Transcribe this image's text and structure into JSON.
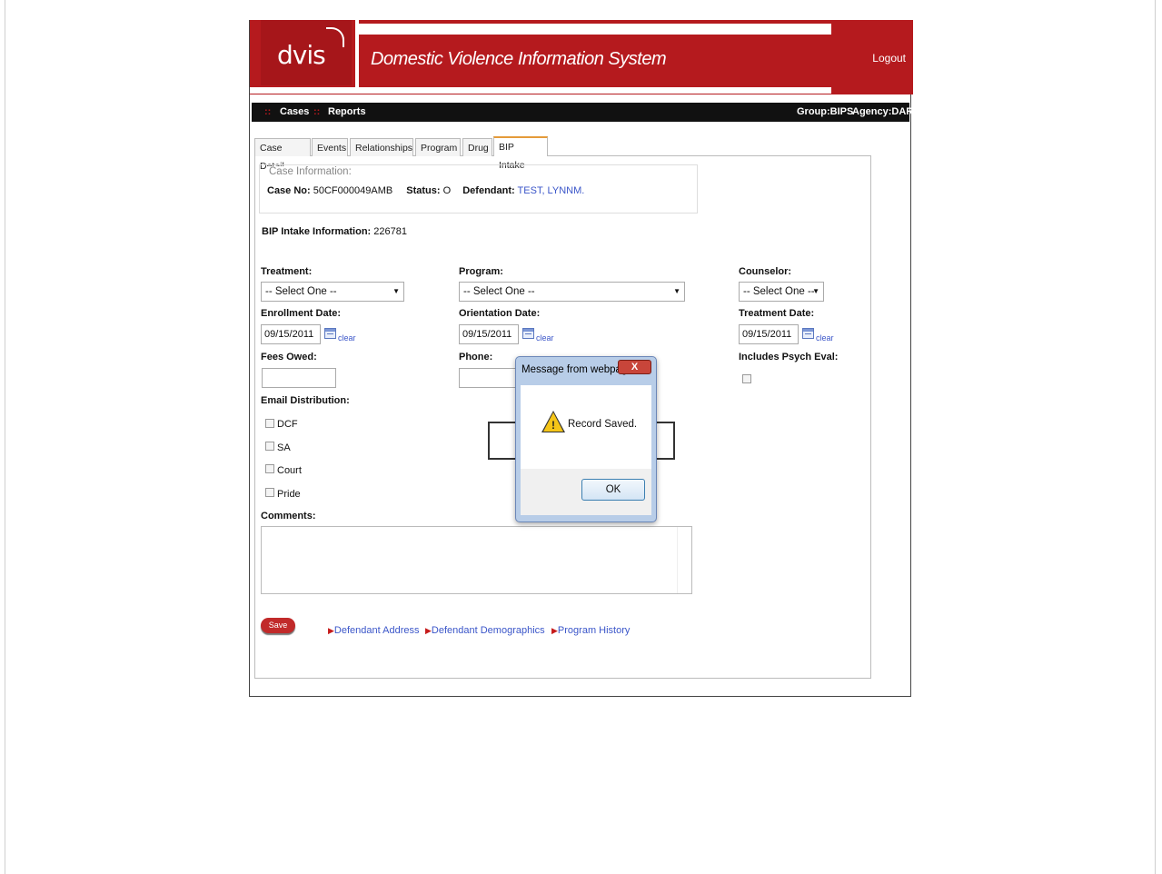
{
  "header": {
    "logo_text": "dvis",
    "title": "Domestic Violence Information System",
    "logout": "Logout"
  },
  "nav": {
    "items": [
      {
        "label": "Cases"
      },
      {
        "label": "Reports"
      }
    ],
    "group": "Group:BIPS",
    "agency": "Agency:DART"
  },
  "tabs": [
    {
      "label": "Case Detail"
    },
    {
      "label": "Events"
    },
    {
      "label": "Relationships"
    },
    {
      "label": "Program"
    },
    {
      "label": "Drug"
    },
    {
      "label": "BIP Intake"
    }
  ],
  "case_info": {
    "legend": "Case Information:",
    "case_no_label": "Case No:",
    "case_no": "50CF000049AMB",
    "status_label": "Status:",
    "status": "O",
    "defendant_label": "Defendant:",
    "defendant": "TEST, LYNNM."
  },
  "bip": {
    "label": "BIP Intake Information:",
    "number": "226781"
  },
  "form": {
    "treatment_label": "Treatment:",
    "treatment_value": "-- Select One --",
    "program_label": "Program:",
    "program_value": "-- Select One --",
    "counselor_label": "Counselor:",
    "counselor_value": "-- Select One --",
    "enrollment_label": "Enrollment Date:",
    "enrollment_value": "09/15/2011",
    "orientation_label": "Orientation Date:",
    "orientation_value": "09/15/2011",
    "treatment_date_label": "Treatment Date:",
    "treatment_date_value": "09/15/2011",
    "clear": "clear",
    "fees_label": "Fees Owed:",
    "phone_label": "Phone:",
    "psych_label": "Includes Psych Eval:",
    "email_label": "Email Distribution:",
    "email_options": [
      {
        "label": "DCF"
      },
      {
        "label": "SA"
      },
      {
        "label": "Court"
      },
      {
        "label": "Pride"
      }
    ],
    "comments_label": "Comments:"
  },
  "actions": {
    "save": "Save",
    "links": [
      {
        "label": "Defendant Address"
      },
      {
        "label": "Defendant Demographics"
      },
      {
        "label": "Program History"
      }
    ]
  },
  "dialog": {
    "title": "Message from webpage",
    "close": "X",
    "message": "Record Saved.",
    "ok": "OK"
  },
  "colors": {
    "brand_red": "#b51a1e",
    "link_blue": "#3b56c9",
    "nav_black": "#111111"
  }
}
